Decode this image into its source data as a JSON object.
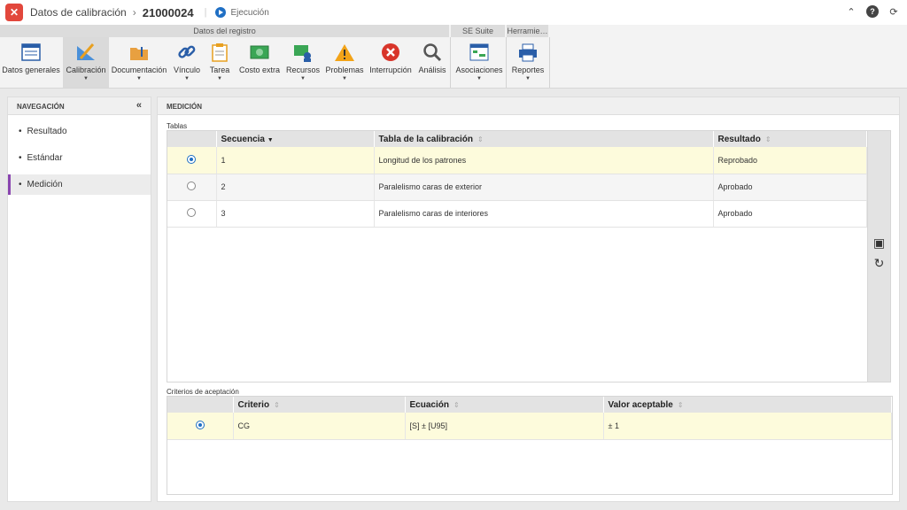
{
  "header": {
    "breadcrumb": "Datos de calibración",
    "record_id": "21000024",
    "status": "Ejecución"
  },
  "ribbon": {
    "group_registro": "Datos del registro",
    "group_suite": "SE Suite",
    "group_herramientas": "Herramie…",
    "buttons": {
      "datos_generales": "Datos generales",
      "calibracion": "Calibración",
      "documentacion": "Documentación",
      "vinculo": "Vínculo",
      "tarea": "Tarea",
      "costo_extra": "Costo extra",
      "recursos": "Recursos",
      "problemas": "Problemas",
      "interrupcion": "Interrupción",
      "analisis": "Análisis",
      "asociaciones": "Asociaciones",
      "reportes": "Reportes"
    }
  },
  "nav": {
    "title": "NAVEGACIÓN",
    "items": [
      "Resultado",
      "Estándar",
      "Medición"
    ]
  },
  "main": {
    "title": "MEDICIÓN",
    "tablas_label": "Tablas",
    "tablas_headers": [
      "Secuencia",
      "Tabla de la calibración",
      "Resultado"
    ],
    "tablas_rows": [
      {
        "seq": "1",
        "tabla": "Longitud de los patrones",
        "resultado": "Reprobado"
      },
      {
        "seq": "2",
        "tabla": "Paralelismo caras de exterior",
        "resultado": "Aprobado"
      },
      {
        "seq": "3",
        "tabla": "Paralelismo caras de interiores",
        "resultado": "Aprobado"
      }
    ],
    "criterios_label": "Criterios de aceptación",
    "criterios_headers": [
      "Criterio",
      "Ecuación",
      "Valor aceptable"
    ],
    "criterios_rows": [
      {
        "criterio": "CG",
        "ecuacion": "[S] ± [U95]",
        "valor": "± 1"
      }
    ]
  }
}
